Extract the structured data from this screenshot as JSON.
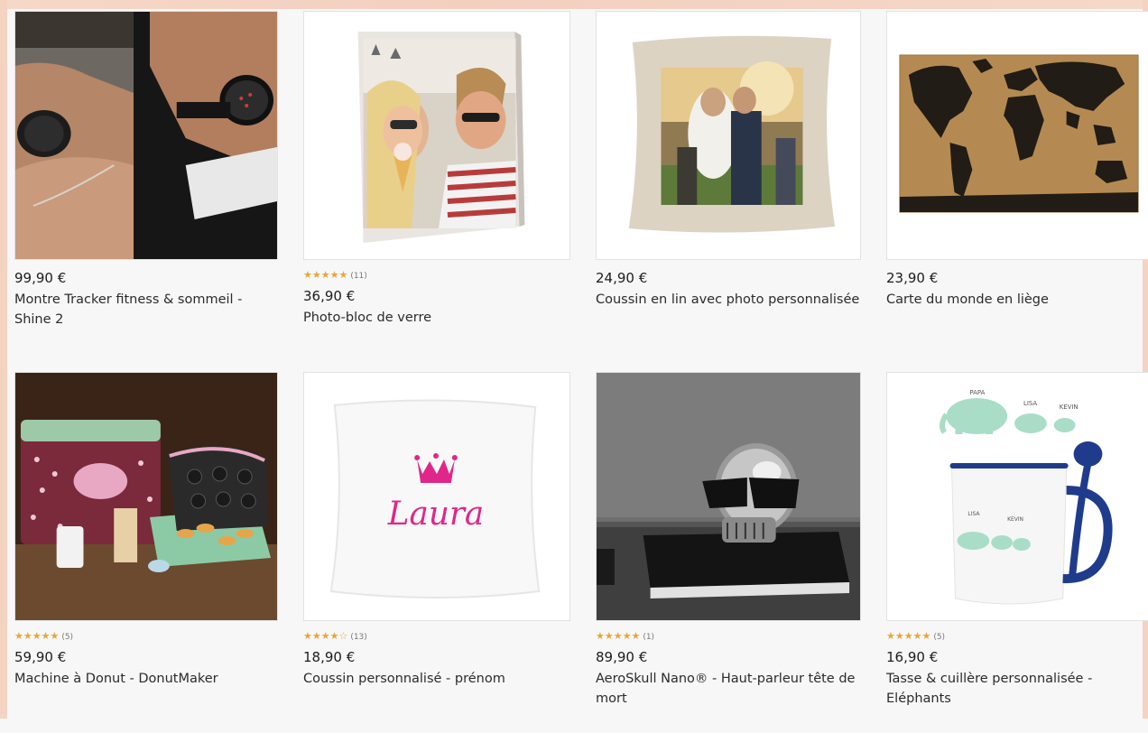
{
  "products": [
    {
      "price": "99,90 €",
      "title": "Montre Tracker fitness & sommeil - Shine 2",
      "stars": "",
      "count": "",
      "image_icon": "fitness-tracker-photo"
    },
    {
      "price": "36,90 €",
      "title": "Photo-bloc de verre",
      "stars": "★★★★★",
      "count": "(11)",
      "image_icon": "glass-photo-block-photo"
    },
    {
      "price": "24,90 €",
      "title": "Coussin en lin avec photo personnalisée",
      "stars": "",
      "count": "",
      "image_icon": "linen-photo-cushion-photo"
    },
    {
      "price": "23,90 €",
      "title": "Carte du monde en liège",
      "stars": "",
      "count": "",
      "image_icon": "cork-world-map-photo"
    },
    {
      "price": "59,90 €",
      "title": "Machine à Donut - DonutMaker",
      "stars": "★★★★★",
      "count": "(5)",
      "image_icon": "donut-maker-photo"
    },
    {
      "price": "18,90 €",
      "title": "Coussin personnalisé - prénom",
      "stars": "★★★★☆",
      "count": "(13)",
      "image_icon": "name-cushion-photo",
      "cushion_text": "Laura"
    },
    {
      "price": "89,90 €",
      "title": "AeroSkull Nano® - Haut-parleur tête de mort",
      "stars": "★★★★★",
      "count": "(1)",
      "image_icon": "skull-speaker-photo"
    },
    {
      "price": "16,90 €",
      "title": "Tasse & cuillère personnalisée - Eléphants",
      "stars": "★★★★★",
      "count": "(5)",
      "image_icon": "elephant-mug-photo",
      "mug_names": [
        "PAPA",
        "LISA",
        "KEVIN"
      ]
    }
  ],
  "colors": {
    "star": "#e8a53a",
    "text": "#2b2b2b",
    "border": "#e2e2e2"
  }
}
